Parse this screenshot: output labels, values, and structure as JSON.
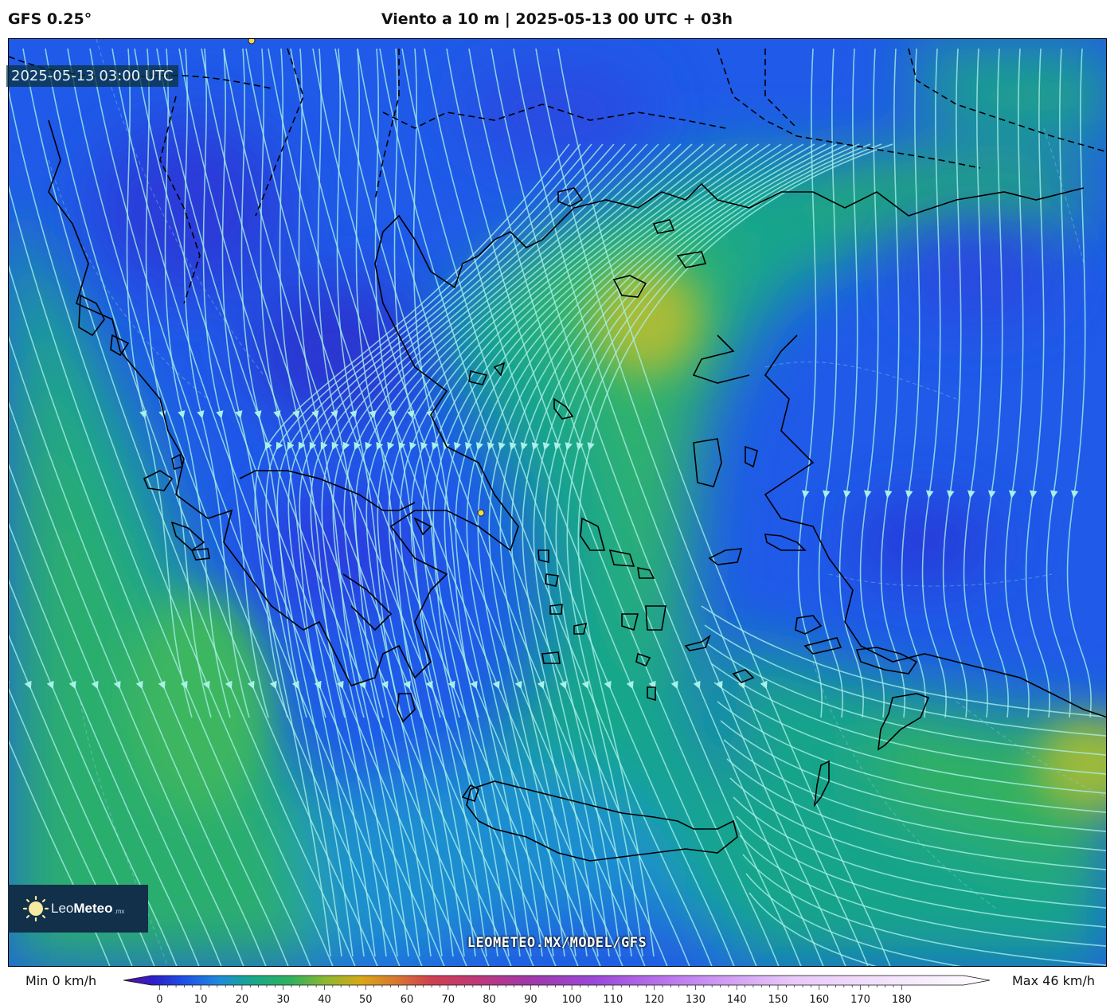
{
  "header": {
    "model": "GFS 0.25°",
    "title": "Viento a 10 m | 2025-05-13 00 UTC + 03h"
  },
  "map": {
    "valid_time": "2025-05-13 03:00 UTC",
    "watermark": "LEOMETEO.MX/MODEL/GFS",
    "logo": {
      "leo": "Leo",
      "meteo": "Meteo",
      "mx": ".mx"
    },
    "colors": {
      "calm": "#2b3fe0",
      "moderate": "#14a68a",
      "fresh": "#3cb86a",
      "strong": "#b8c030",
      "streamline": "#a8f0e8",
      "coastline": "#000000",
      "marker": "#f0d850"
    }
  },
  "legend": {
    "min_label": "Min 0 km/h",
    "max_label": "Max 46 km/h",
    "unit": "km/h",
    "ticks": [
      "0",
      "10",
      "20",
      "30",
      "40",
      "50",
      "60",
      "70",
      "80",
      "90",
      "100",
      "110",
      "120",
      "130",
      "140",
      "150",
      "160",
      "170",
      "180"
    ],
    "range": [
      -2,
      195
    ],
    "stops": [
      {
        "value": -2,
        "color": "#5a0f9a"
      },
      {
        "value": 5,
        "color": "#2a1fc8"
      },
      {
        "value": 12,
        "color": "#1f52e8"
      },
      {
        "value": 20,
        "color": "#1f8cd8"
      },
      {
        "value": 27,
        "color": "#16a88c"
      },
      {
        "value": 36,
        "color": "#30b060"
      },
      {
        "value": 44,
        "color": "#8cb830"
      },
      {
        "value": 52,
        "color": "#d8a818"
      },
      {
        "value": 60,
        "color": "#d87830"
      },
      {
        "value": 68,
        "color": "#d04050"
      },
      {
        "value": 78,
        "color": "#c03878"
      },
      {
        "value": 90,
        "color": "#a038a8"
      },
      {
        "value": 105,
        "color": "#9a48d8"
      },
      {
        "value": 125,
        "color": "#c080f0"
      },
      {
        "value": 150,
        "color": "#e8c8f8"
      },
      {
        "value": 195,
        "color": "#ffffff"
      }
    ]
  }
}
